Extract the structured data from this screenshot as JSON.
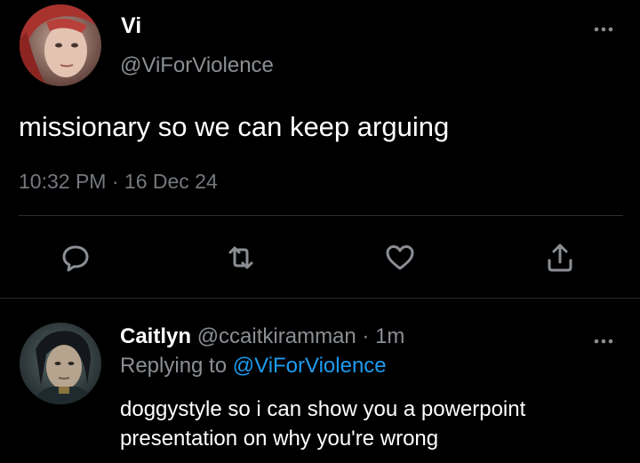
{
  "main_tweet": {
    "display_name": "Vi",
    "handle": "@ViForViolence",
    "text": "missionary so we can keep arguing",
    "time": "10:32 PM",
    "separator": " · ",
    "date": "16 Dec 24",
    "avatar_icon": "avatar-vi",
    "more_icon": "more-horizontal-icon",
    "actions": {
      "reply_icon": "reply-icon",
      "retweet_icon": "retweet-icon",
      "like_icon": "heart-icon",
      "share_icon": "share-icon"
    }
  },
  "reply_tweet": {
    "display_name": "Caitlyn",
    "handle": "@ccaitkiramman",
    "separator": " · ",
    "time": "1m",
    "replying_to_prefix": "Replying to ",
    "replying_to_handle": "@ViForViolence",
    "text_lines": [
      "doggystyle so i can show you a powerpoint",
      "presentation on why you're wrong"
    ],
    "avatar_icon": "avatar-caitlyn",
    "more_icon": "more-horizontal-icon"
  },
  "colors": {
    "background": "#000000",
    "primary_text": "#ffffff",
    "secondary_text": "#8b8f94",
    "link": "#1d9bf0",
    "divider": "#2a2d30"
  }
}
